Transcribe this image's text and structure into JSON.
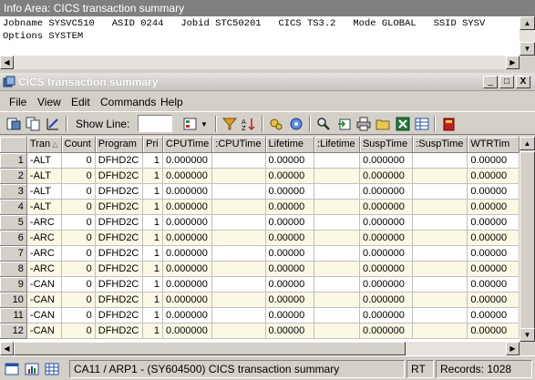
{
  "info": {
    "title": "Info Area: CICS transaction summary",
    "line1": "Jobname SYSVC510   ASID 0244   Jobid STC50201   CICS TS3.2   Mode GLOBAL   SSID SYSV",
    "line2": "Options SYSTEM"
  },
  "window": {
    "title": "CICS transaction summary",
    "minimize": "_",
    "maximize": "□",
    "close": "X"
  },
  "menu": [
    "File",
    "View",
    "Edit",
    "Commands",
    "Help"
  ],
  "toolbar": {
    "show_line_label": "Show Line:",
    "show_line_value": ""
  },
  "grid": {
    "columns": [
      "Tran",
      "Count",
      "Program",
      "Pri",
      "CPUTime",
      ":CPUTime",
      "Lifetime",
      ":Lifetime",
      "SuspTime",
      ":SuspTime",
      "WTRTim"
    ],
    "rows": [
      [
        "1",
        "-ALT",
        "0",
        "DFHD2C",
        "1",
        "0.000000",
        "",
        "0.00000",
        "",
        "0.000000",
        "",
        "0.00000"
      ],
      [
        "2",
        "-ALT",
        "0",
        "DFHD2C",
        "1",
        "0.000000",
        "",
        "0.00000",
        "",
        "0.000000",
        "",
        "0.00000"
      ],
      [
        "3",
        "-ALT",
        "0",
        "DFHD2C",
        "1",
        "0.000000",
        "",
        "0.00000",
        "",
        "0.000000",
        "",
        "0.00000"
      ],
      [
        "4",
        "-ALT",
        "0",
        "DFHD2C",
        "1",
        "0.000000",
        "",
        "0.00000",
        "",
        "0.000000",
        "",
        "0.00000"
      ],
      [
        "5",
        "-ARC",
        "0",
        "DFHD2C",
        "1",
        "0.000000",
        "",
        "0.00000",
        "",
        "0.000000",
        "",
        "0.00000"
      ],
      [
        "6",
        "-ARC",
        "0",
        "DFHD2C",
        "1",
        "0.000000",
        "",
        "0.00000",
        "",
        "0.000000",
        "",
        "0.00000"
      ],
      [
        "7",
        "-ARC",
        "0",
        "DFHD2C",
        "1",
        "0.000000",
        "",
        "0.00000",
        "",
        "0.000000",
        "",
        "0.00000"
      ],
      [
        "8",
        "-ARC",
        "0",
        "DFHD2C",
        "1",
        "0.000000",
        "",
        "0.00000",
        "",
        "0.000000",
        "",
        "0.00000"
      ],
      [
        "9",
        "-CAN",
        "0",
        "DFHD2C",
        "1",
        "0.000000",
        "",
        "0.00000",
        "",
        "0.000000",
        "",
        "0.00000"
      ],
      [
        "10",
        "-CAN",
        "0",
        "DFHD2C",
        "1",
        "0.000000",
        "",
        "0.00000",
        "",
        "0.000000",
        "",
        "0.00000"
      ],
      [
        "11",
        "-CAN",
        "0",
        "DFHD2C",
        "1",
        "0.000000",
        "",
        "0.00000",
        "",
        "0.000000",
        "",
        "0.00000"
      ],
      [
        "12",
        "-CAN",
        "0",
        "DFHD2C",
        "1",
        "0.000000",
        "",
        "0.00000",
        "",
        "0.000000",
        "",
        "0.00000"
      ]
    ]
  },
  "status": {
    "path": "CA11 / ARP1 - (SY604500) CICS transaction summary",
    "mode": "RT",
    "records": "Records: 1028"
  },
  "colors": {
    "alt_row": "#fbf8e4",
    "chrome": "#d4d0c8",
    "info_title": "#808080"
  }
}
